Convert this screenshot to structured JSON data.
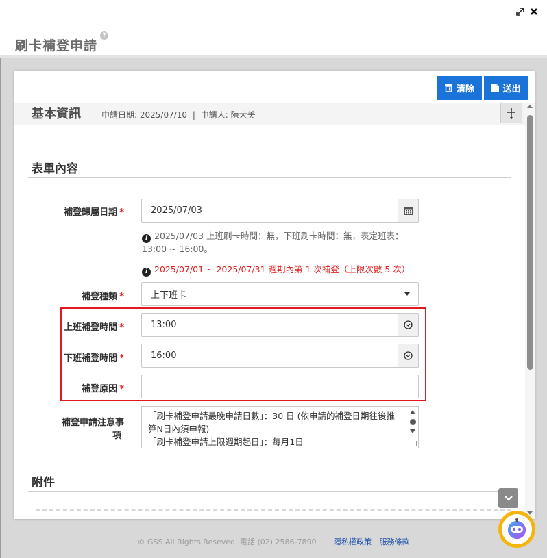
{
  "window": {
    "expand_icon": "expand-icon",
    "close_icon": "close-icon"
  },
  "page": {
    "title": "刷卡補登申請",
    "help_icon": "question-icon"
  },
  "toolbar": {
    "clear_label": "清除",
    "send_label": "送出"
  },
  "basic": {
    "title": "基本資訊",
    "apply_date": "申請日期: 2025/07/10",
    "separator": "|",
    "applicant": "申請人: 陳大美"
  },
  "form": {
    "title": "表單內容",
    "date_label": "補登歸屬日期",
    "date_value": "2025/07/03",
    "info1_line1": "2025/07/03 上班刷卡時間：無，下班刷卡時間：無，表定班表：",
    "info1_line2": "13:00 ~ 16:00。",
    "info2": "2025/07/01 ~ 2025/07/31 週期內第 1 次補登（上限次數 5 次）",
    "type_label": "補登種類",
    "type_value": "上下班卡",
    "start_label": "上班補登時間",
    "start_value": "13:00",
    "end_label": "下班補登時間",
    "end_value": "16:00",
    "reason_label": "補登原因",
    "reason_value": "",
    "notes_label_1": "補登申請注意事",
    "notes_label_2": "項",
    "notes_line1": "「刷卡補登申請最晚申請日數」：30 日 (依申請的補登日期往後推",
    "notes_line2": "算N日內須申報)",
    "notes_line3": "「刷卡補登申請上限週期起日」：每月1日"
  },
  "attach": {
    "title": "附件"
  },
  "footer": {
    "copyright": "© GSS All Rights Reseved. 電話 (02) 2586-7890",
    "privacy": "隱私權政策",
    "terms": "服務條款"
  },
  "colors": {
    "primary": "#1a73d9",
    "required": "#d9302e",
    "highlight": "#e0191f",
    "assistant": "#f6b50d"
  }
}
